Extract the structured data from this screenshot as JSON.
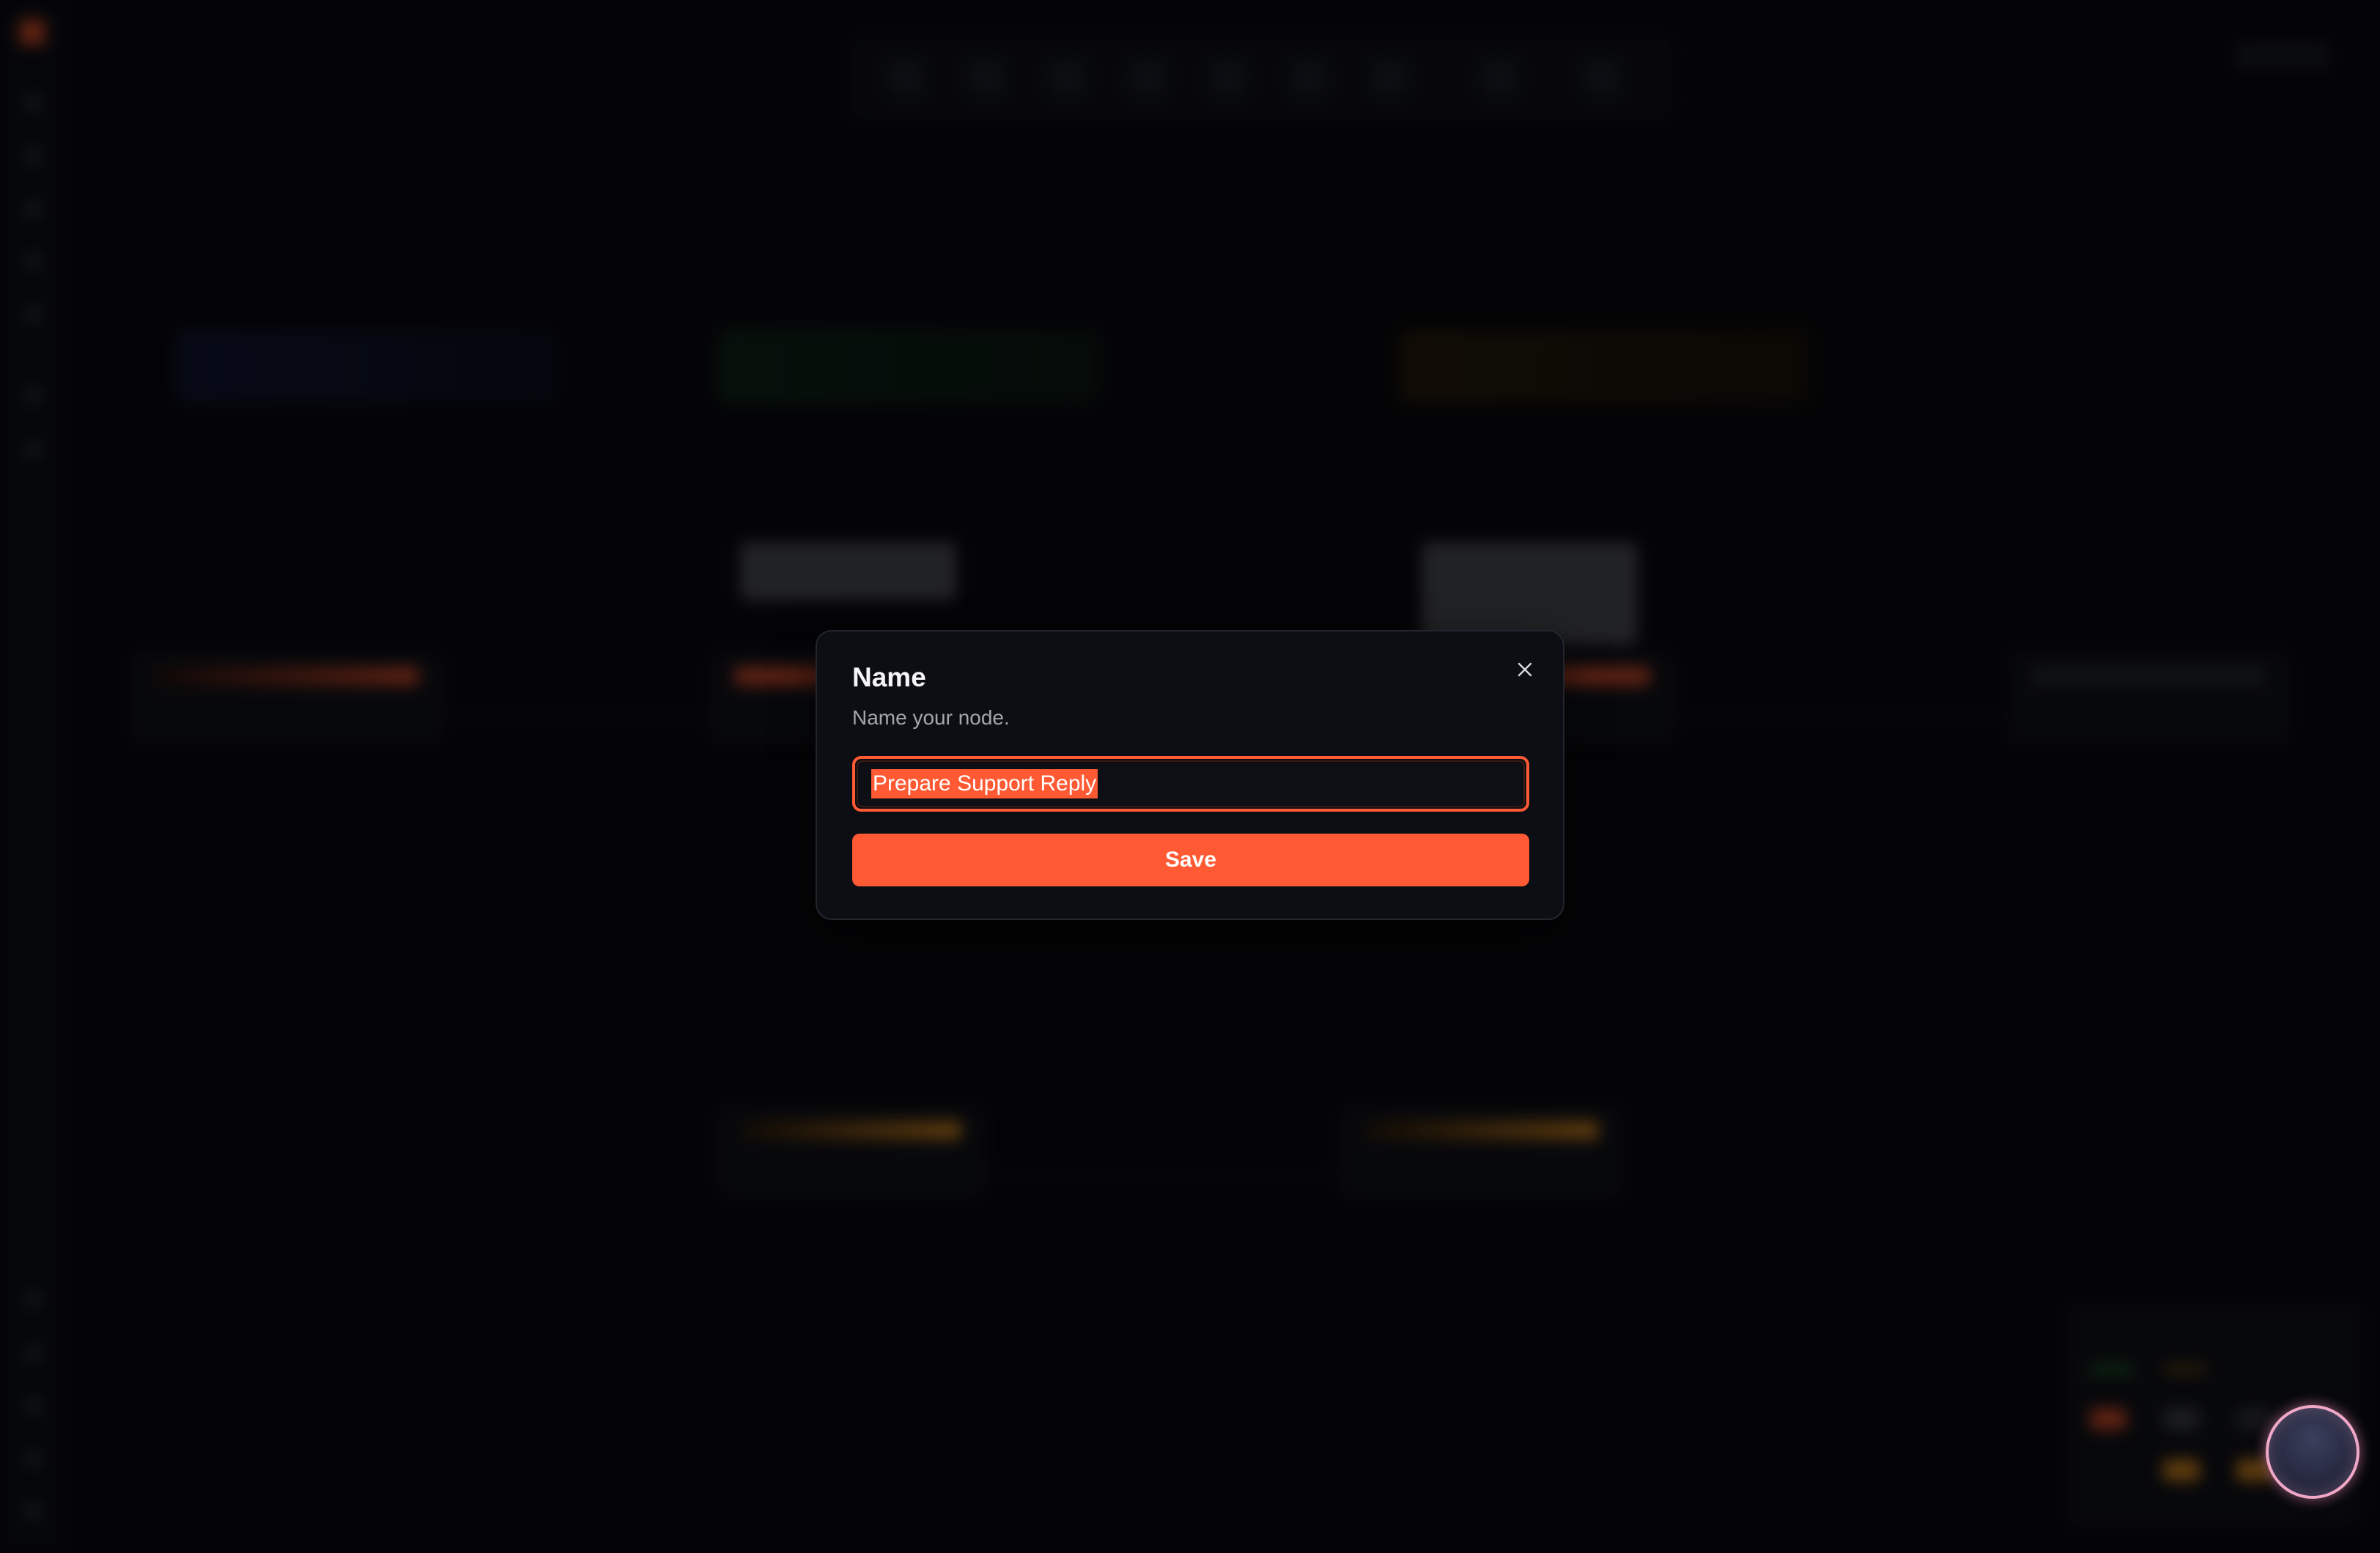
{
  "dialog": {
    "title": "Name",
    "description": "Name your node.",
    "input_value": "Prepare Support Reply",
    "save_label": "Save",
    "close_icon": "close-icon"
  },
  "assistant": {
    "icon": "assistant-orb-icon"
  },
  "colors": {
    "accent": "#ff5a33",
    "dialog_bg": "#0c0e13",
    "page_bg": "#07070a"
  }
}
